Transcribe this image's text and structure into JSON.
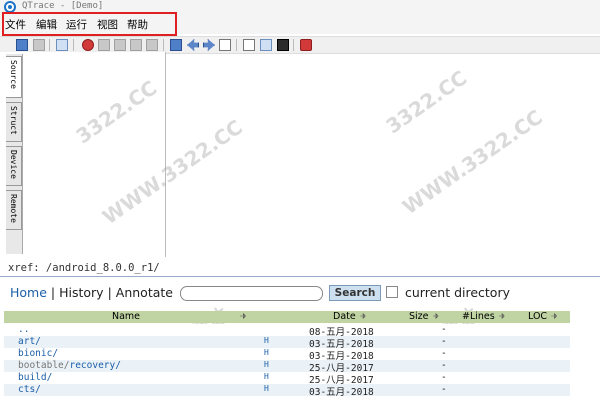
{
  "window": {
    "title": "QTrace - [Demo]"
  },
  "menu": {
    "items": [
      "文件",
      "编辑",
      "运行",
      "视图",
      "帮助"
    ]
  },
  "toolbar": {
    "icons": [
      "layers-icon",
      "stop-icon",
      "database-icon",
      "record-icon",
      "redo-icon",
      "step-down-icon",
      "step-up-icon",
      "play-icon",
      "search-icon",
      "back-icon",
      "forward-icon",
      "window-icon",
      "window-split-icon",
      "image-icon",
      "terminal-icon",
      "close-record-icon"
    ]
  },
  "sidebar": {
    "tabs": [
      {
        "label": "Source"
      },
      {
        "label": "Struct"
      },
      {
        "label": "Device"
      },
      {
        "label": "Remote"
      }
    ]
  },
  "xref": "xref: /android_8.0.0_r1/",
  "nav": {
    "home": "Home",
    "history": "History",
    "annotate": "Annotate",
    "sep": "|",
    "search_value": "",
    "search_button": "Search",
    "current_dir_label": "current directory"
  },
  "table": {
    "headers": {
      "name": "Name",
      "date": "Date",
      "size": "Size",
      "lines": "#Lines",
      "loc": "LOC"
    },
    "rows": [
      {
        "name": "..",
        "h": "",
        "date": "08-五月-2018",
        "size": "-"
      },
      {
        "name": "art/",
        "h": "H",
        "date": "03-五月-2018",
        "size": "-"
      },
      {
        "name": "bionic/",
        "h": "H",
        "date": "03-五月-2018",
        "size": "-"
      },
      {
        "name_prefix": "bootable/",
        "name": "recovery/",
        "h": "H",
        "date": "25-八月-2017",
        "size": "-"
      },
      {
        "name": "build/",
        "h": "H",
        "date": "25-八月-2017",
        "size": "-"
      },
      {
        "name": "cts/",
        "h": "H",
        "date": "03-五月-2018",
        "size": "-"
      }
    ]
  },
  "watermarks": [
    "3322.CC",
    "WWW.3322.CC",
    "3322下载站"
  ],
  "colors": {
    "menu_highlight": "#e02020",
    "link": "#1b5fa8",
    "table_header": "#bfd3a3",
    "row_alt": "#eaf1f7"
  }
}
